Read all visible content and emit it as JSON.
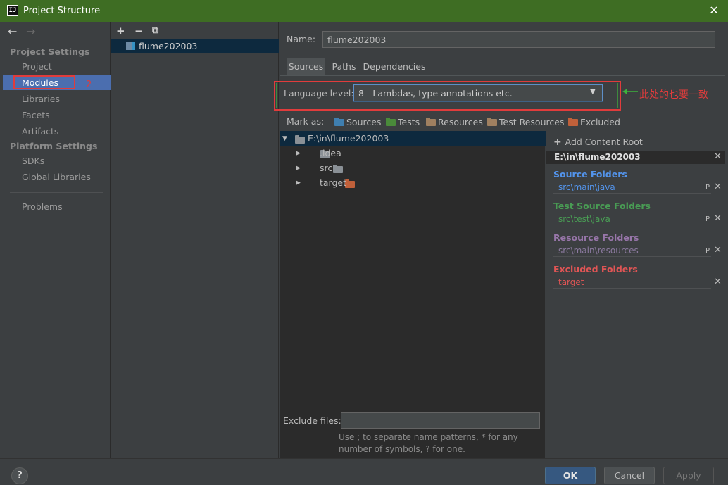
{
  "window": {
    "title": "Project Structure",
    "app_icon_text": "IJ"
  },
  "sidebar": {
    "sections": [
      {
        "header": "Project Settings",
        "items": [
          "Project",
          "Modules",
          "Libraries",
          "Facets",
          "Artifacts"
        ]
      },
      {
        "header": "Platform Settings",
        "items": [
          "SDKs",
          "Global Libraries"
        ]
      }
    ],
    "problems": "Problems",
    "selected": "Modules",
    "annotation": "2"
  },
  "module_list": {
    "toolbar": [
      "+",
      "−",
      "⧉"
    ],
    "modules": [
      "flume202003"
    ]
  },
  "module": {
    "name_label": "Name:",
    "name_value": "flume202003",
    "tabs": [
      "Sources",
      "Paths",
      "Dependencies"
    ],
    "active_tab": "Sources",
    "language_level_label": "Language level:",
    "language_level_value": "8 - Lambdas, type annotations etc.",
    "annotation": "此处的也要一致",
    "mark_as_label": "Mark as:",
    "mark_as": [
      {
        "label": "Sources",
        "color": "#3f7fb0"
      },
      {
        "label": "Tests",
        "color": "#4a8a3a"
      },
      {
        "label": "Resources",
        "color": "#a08060"
      },
      {
        "label": "Test Resources",
        "color": "#a08060"
      },
      {
        "label": "Excluded",
        "color": "#c0603a"
      }
    ],
    "tree": {
      "root": "E:\\in\\flume202003",
      "children": [
        {
          "label": ".idea",
          "color": "#8a9096"
        },
        {
          "label": "src",
          "color": "#8a9096"
        },
        {
          "label": "target",
          "color": "#c0603a"
        }
      ]
    },
    "exclude_label": "Exclude files:",
    "exclude_value": "",
    "exclude_help": "Use ; to separate name patterns, * for any number of symbols, ? for one."
  },
  "content_root": {
    "add_label": "Add Content Root",
    "path": "E:\\in\\flume202003",
    "folders": [
      {
        "title": "Source Folders",
        "path": "src\\main\\java",
        "color": "#5394ec",
        "path_color": "#5394ec"
      },
      {
        "title": "Test Source Folders",
        "path": "src\\test\\java",
        "color": "#499c54",
        "path_color": "#499c54"
      },
      {
        "title": "Resource Folders",
        "path": "src\\main\\resources",
        "color": "#9876aa",
        "path_color": "#8c7aa0"
      },
      {
        "title": "Excluded Folders",
        "path": "target",
        "color": "#e05555",
        "path_color": "#e05555"
      }
    ],
    "properties_glyph": "P",
    "remove_glyph": "✕"
  },
  "buttons": {
    "help": "?",
    "ok": "OK",
    "cancel": "Cancel",
    "apply": "Apply"
  },
  "colors": {
    "titlebar": "#3e6d23",
    "selection": "#4b6eaf",
    "annotation_red": "#e03c3c"
  }
}
